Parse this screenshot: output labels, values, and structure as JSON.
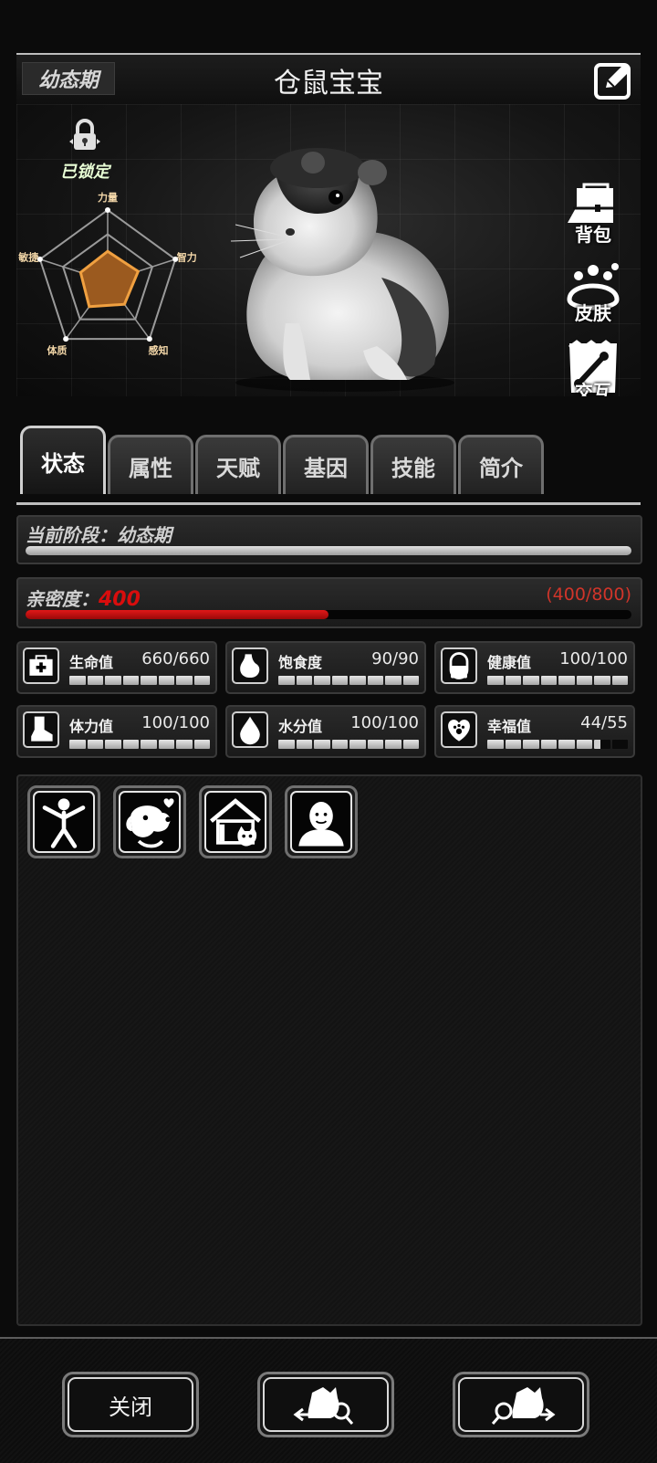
{
  "header": {
    "stage_badge": "幼态期",
    "pet_name": "仓鼠宝宝",
    "edit_icon": "edit-icon"
  },
  "lock": {
    "label": "已锁定",
    "icon": "padlock-icon"
  },
  "radar": {
    "axes": [
      "力量",
      "智力",
      "感知",
      "体质",
      "敏捷"
    ],
    "values": [
      0.42,
      0.45,
      0.4,
      0.44,
      0.4
    ],
    "fill_color": "#9b5a1f",
    "stroke_color": "#f0a040"
  },
  "side_buttons": [
    {
      "label": "背包",
      "icon": "backpack-icon"
    },
    {
      "label": "皮肤",
      "icon": "skin-icon"
    },
    {
      "label": "交互",
      "icon": "interact-icon"
    }
  ],
  "tabs": [
    "状态",
    "属性",
    "天赋",
    "基因",
    "技能",
    "简介"
  ],
  "stage_bar": {
    "label": "当前阶段：幼态期",
    "progress": 1.0
  },
  "affinity": {
    "label": "亲密度：",
    "value": "400",
    "range": "(400/800)",
    "progress": 0.5
  },
  "stats": [
    {
      "name": "生命值",
      "value": "660/660",
      "icon": "first-aid-icon",
      "progress": 1.0
    },
    {
      "name": "饱食度",
      "value": "90/90",
      "icon": "stomach-icon",
      "progress": 1.0
    },
    {
      "name": "健康值",
      "value": "100/100",
      "icon": "capsule-icon",
      "progress": 1.0
    },
    {
      "name": "体力值",
      "value": "100/100",
      "icon": "foot-icon",
      "progress": 1.0
    },
    {
      "name": "水分值",
      "value": "100/100",
      "icon": "water-drop-icon",
      "progress": 1.0
    },
    {
      "name": "幸福值",
      "value": "44/55",
      "icon": "heart-paw-icon",
      "progress": 0.8
    }
  ],
  "actions": [
    {
      "icon": "stretch-icon"
    },
    {
      "icon": "pet-dog-icon"
    },
    {
      "icon": "pet-house-icon"
    },
    {
      "icon": "bald-head-icon"
    }
  ],
  "bottom": {
    "close_label": "关闭",
    "prev_icon": "prev-pet-icon",
    "next_icon": "next-pet-icon"
  }
}
